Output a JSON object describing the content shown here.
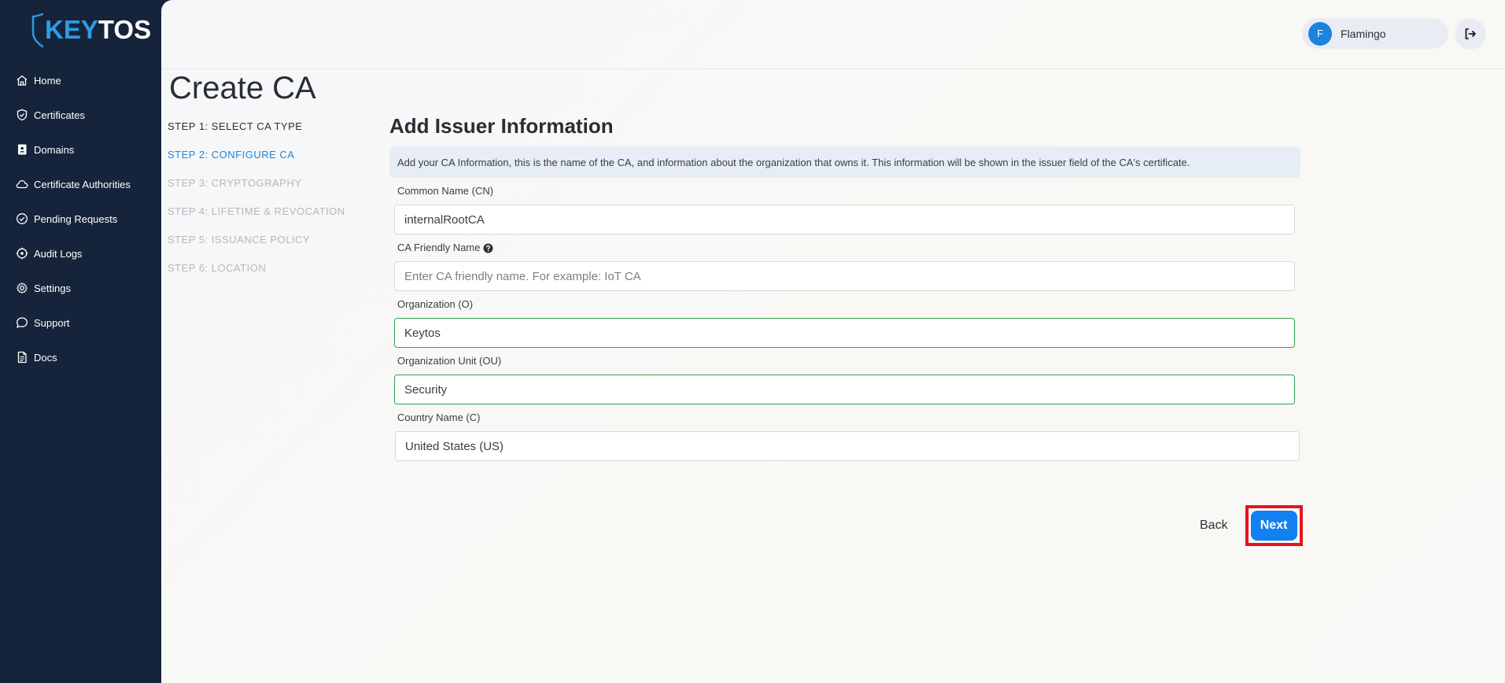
{
  "brand": {
    "logo_part1": "KEY",
    "logo_part2": "TOS"
  },
  "sidebar": {
    "items": [
      {
        "label": "Home",
        "icon": "home-icon"
      },
      {
        "label": "Certificates",
        "icon": "shield-check-icon"
      },
      {
        "label": "Domains",
        "icon": "contact-book-icon"
      },
      {
        "label": "Certificate Authorities",
        "icon": "cloud-icon"
      },
      {
        "label": "Pending Requests",
        "icon": "check-circle-icon"
      },
      {
        "label": "Audit Logs",
        "icon": "audit-target-icon"
      },
      {
        "label": "Settings",
        "icon": "gear-icon"
      },
      {
        "label": "Support",
        "icon": "chat-bubble-icon"
      },
      {
        "label": "Docs",
        "icon": "document-icon"
      }
    ]
  },
  "header": {
    "user_initial": "F",
    "user_name": "Flamingo",
    "logout_icon": "logout-icon"
  },
  "page": {
    "title": "Create CA"
  },
  "steps": [
    {
      "label": "STEP 1: SELECT CA TYPE",
      "state": "done"
    },
    {
      "label": "STEP 2: CONFIGURE CA",
      "state": "active"
    },
    {
      "label": "STEP 3: CRYPTOGRAPHY",
      "state": "todo"
    },
    {
      "label": "STEP 4: LIFETIME & REVOCATION",
      "state": "todo"
    },
    {
      "label": "STEP 5: ISSUANCE POLICY",
      "state": "todo"
    },
    {
      "label": "STEP 6: LOCATION",
      "state": "todo"
    }
  ],
  "form": {
    "title": "Add Issuer Information",
    "info": "Add your CA Information, this is the name of the CA, and information about the organization that owns it. This information will be shown in the issuer field of the CA's certificate.",
    "common_name": {
      "label": "Common Name (CN)",
      "value": "internalRootCA",
      "placeholder": ""
    },
    "friendly_name": {
      "label": "CA Friendly Name",
      "value": "",
      "placeholder": "Enter CA friendly name. For example: IoT CA"
    },
    "organization": {
      "label": "Organization (O)",
      "value": "Keytos",
      "placeholder": ""
    },
    "org_unit": {
      "label": "Organization Unit (OU)",
      "value": "Security",
      "placeholder": ""
    },
    "country": {
      "label": "Country Name (C)",
      "value": "United States (US)"
    }
  },
  "actions": {
    "back_label": "Back",
    "next_label": "Next"
  },
  "colors": {
    "sidebar_bg": "#15243a",
    "accent": "#1181f2",
    "active_step": "#1f86e0",
    "valid_border": "#2ea44f",
    "highlight": "#e0171f"
  }
}
